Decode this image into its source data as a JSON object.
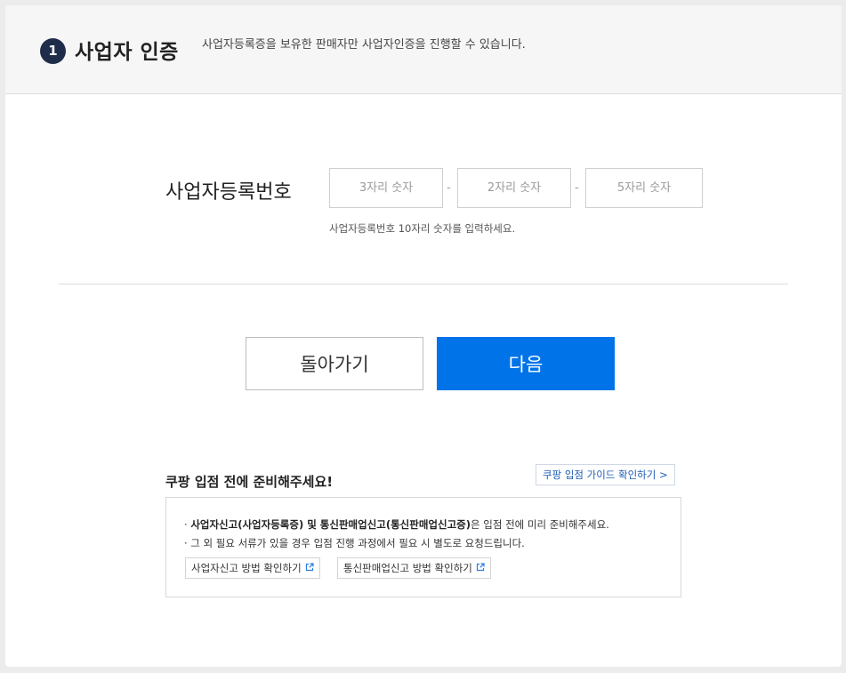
{
  "header": {
    "step_number": "1",
    "title": "사업자 인증",
    "description": "사업자등록증을 보유한 판매자만 사업자인증을 진행할 수 있습니다."
  },
  "brn": {
    "label": "사업자등록번호",
    "field1_placeholder": "3자리 숫자",
    "field2_placeholder": "2자리 숫자",
    "field3_placeholder": "5자리 숫자",
    "separator": "-",
    "help": "사업자등록번호 10자리 숫자를 입력하세요."
  },
  "actions": {
    "back_label": "돌아가기",
    "next_label": "다음"
  },
  "prep": {
    "title": "쿠팡 입점 전에 준비해주세요!",
    "guide_link": "쿠팡 입점 가이드 확인하기 >",
    "bullet1_prefix": "· ",
    "bullet1_bold": "사업자신고(사업자등록증) 및 통신판매업신고(통신판매업신고증)",
    "bullet1_rest": "은 입점 전에 미리 준비해주세요.",
    "bullet2": "· 그 외 필요 서류가 있을 경우 입점 진행 과정에서 필요 시 별도로 요청드립니다.",
    "link1": "사업자신고 방법 확인하기",
    "link2": "통신판매업신고 방법 확인하기"
  },
  "icons": {
    "external_link": "external-link-icon"
  },
  "colors": {
    "primary": "#0073e9",
    "step_badge": "#1f2d4a",
    "link": "#1f5fb5"
  }
}
